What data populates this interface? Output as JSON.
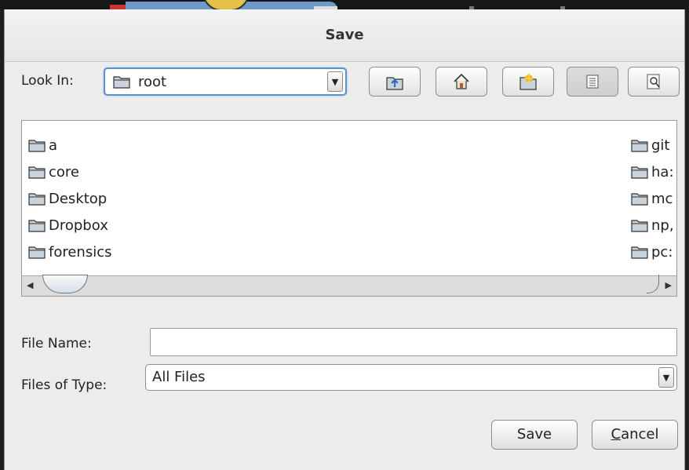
{
  "dialog": {
    "title": "Save"
  },
  "look_in": {
    "label": "Look In:",
    "value": "root"
  },
  "toolbar": {
    "buttons": [
      {
        "name": "up-one-level",
        "icon": "folder-up-icon"
      },
      {
        "name": "home",
        "icon": "home-icon"
      },
      {
        "name": "new-folder",
        "icon": "new-folder-icon"
      },
      {
        "name": "list-view",
        "icon": "list-view-icon",
        "pressed": true
      },
      {
        "name": "details-view",
        "icon": "details-view-icon"
      }
    ]
  },
  "files": {
    "left_column": [
      "a",
      "core",
      "Desktop",
      "Dropbox",
      "forensics"
    ],
    "right_column": [
      "git",
      "ha:",
      "mc",
      "np,",
      "pc:"
    ]
  },
  "file_name": {
    "label": "File Name:",
    "value": ""
  },
  "files_of_type": {
    "label": "Files of Type:",
    "value": "All Files"
  },
  "buttons": {
    "save": "Save",
    "cancel_prefix": "C",
    "cancel_rest": "ancel"
  },
  "colors": {
    "focus_border": "#5c8fcf",
    "folder_fill": "#c9d3dc"
  }
}
